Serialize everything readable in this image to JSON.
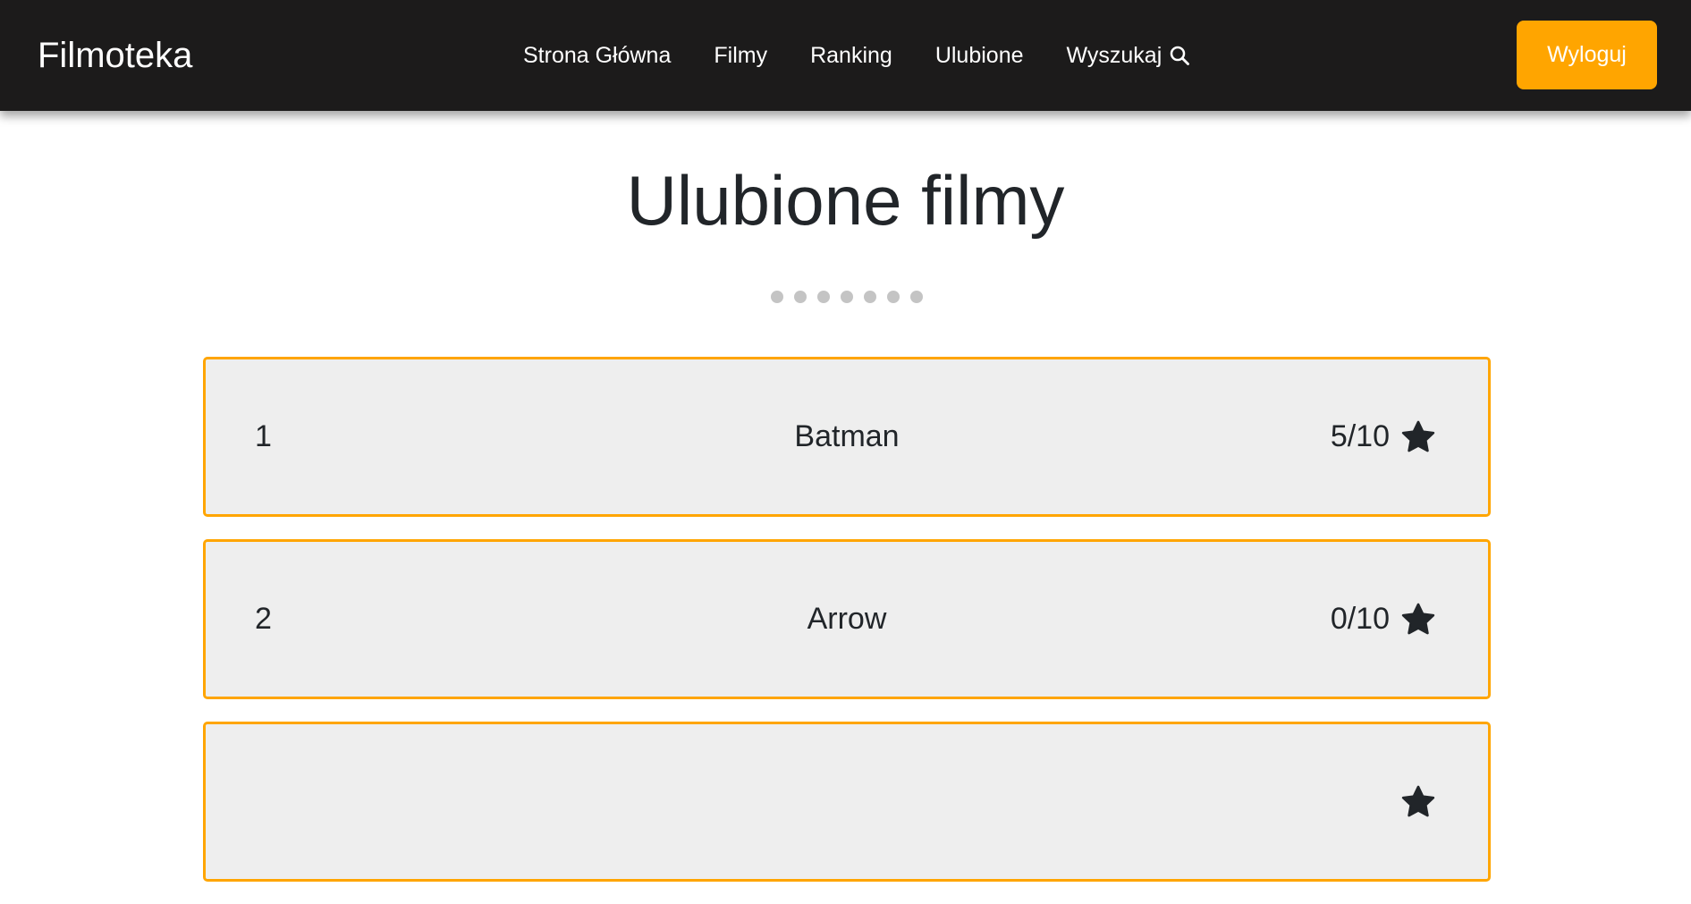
{
  "header": {
    "brand": "Filmoteka",
    "nav": [
      {
        "label": "Strona Główna"
      },
      {
        "label": "Filmy"
      },
      {
        "label": "Ranking"
      },
      {
        "label": "Ulubione"
      },
      {
        "label": "Wyszukaj",
        "icon": "search-icon"
      }
    ],
    "logout_label": "Wyloguj",
    "accent_color": "#ffa500",
    "background_color": "#1c1b1b"
  },
  "main": {
    "title": "Ulubione filmy",
    "loading_dots": 7,
    "movies": [
      {
        "rank": "1",
        "title": "Batman",
        "rating": "5/10",
        "icon": "star-icon"
      },
      {
        "rank": "2",
        "title": "Arrow",
        "rating": "0/10",
        "icon": "star-icon"
      },
      {
        "rank": "",
        "title": "",
        "rating": "",
        "icon": "star-icon"
      }
    ]
  }
}
